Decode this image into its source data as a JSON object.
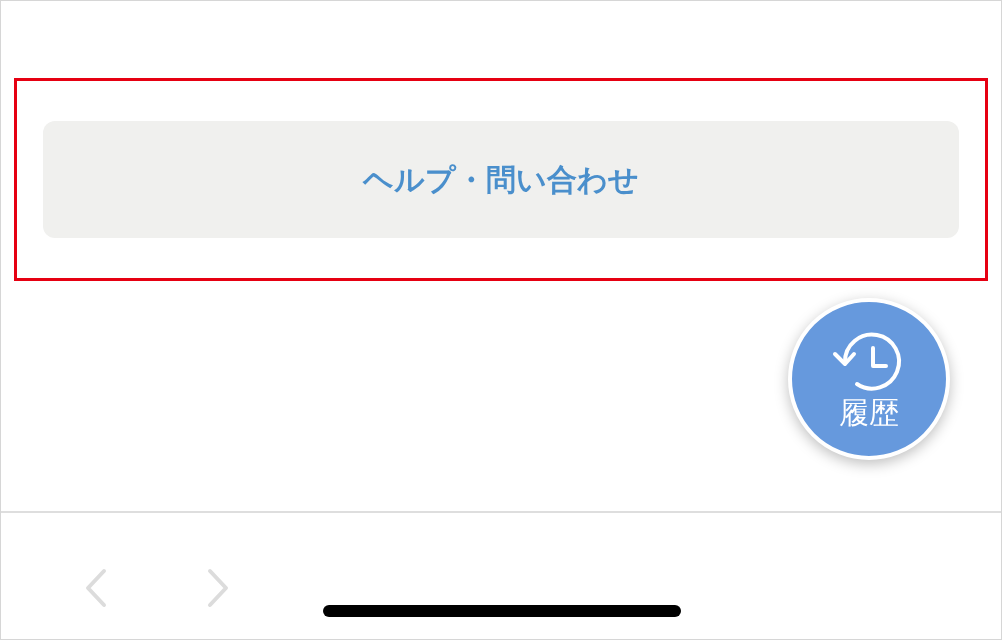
{
  "help_button": {
    "label": "ヘルプ・問い合わせ"
  },
  "history_button": {
    "label": "履歴"
  },
  "toolbar": {
    "back": {
      "disabled": true
    },
    "forward": {
      "disabled": true
    }
  }
}
